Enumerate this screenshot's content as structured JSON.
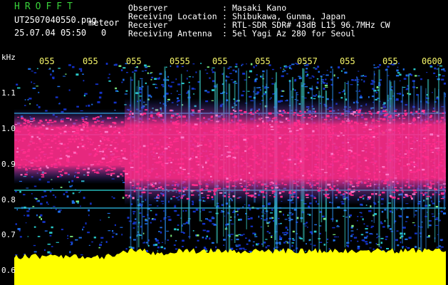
{
  "header": {
    "app_title": "HROFFT",
    "file_name": "UT2507040550.png",
    "meteor_label": "meteor",
    "date_time": "25.07.04 05:50",
    "count": "0"
  },
  "info": {
    "labels": [
      "Observer",
      "Receiving Location",
      "Receiver",
      "Receiving Antenna"
    ],
    "separator": ":",
    "values": [
      "Masaki Kano",
      "Shibukawa, Gunma, Japan",
      "RTL-SDR SDR# 43dB L15 96.7MHz CW",
      "5el Yagi Az 280 for Seoul"
    ]
  },
  "axis": {
    "unit": "kHz",
    "y_ticks": [
      "1.1",
      "1.0",
      "0.9",
      "0.8",
      "0.7",
      "0.6"
    ],
    "x_ticks": [
      "055",
      "055",
      "055",
      "0555",
      "055",
      "055",
      "0557",
      "055",
      "055",
      "0600"
    ]
  },
  "colors": {
    "background": "#000000",
    "title": "#39d23a",
    "tick_label": "#f7f76a",
    "noise_blue": "#1432c8",
    "signal_pink": "#ff2d8c",
    "floor_yellow": "#ffff00"
  }
}
